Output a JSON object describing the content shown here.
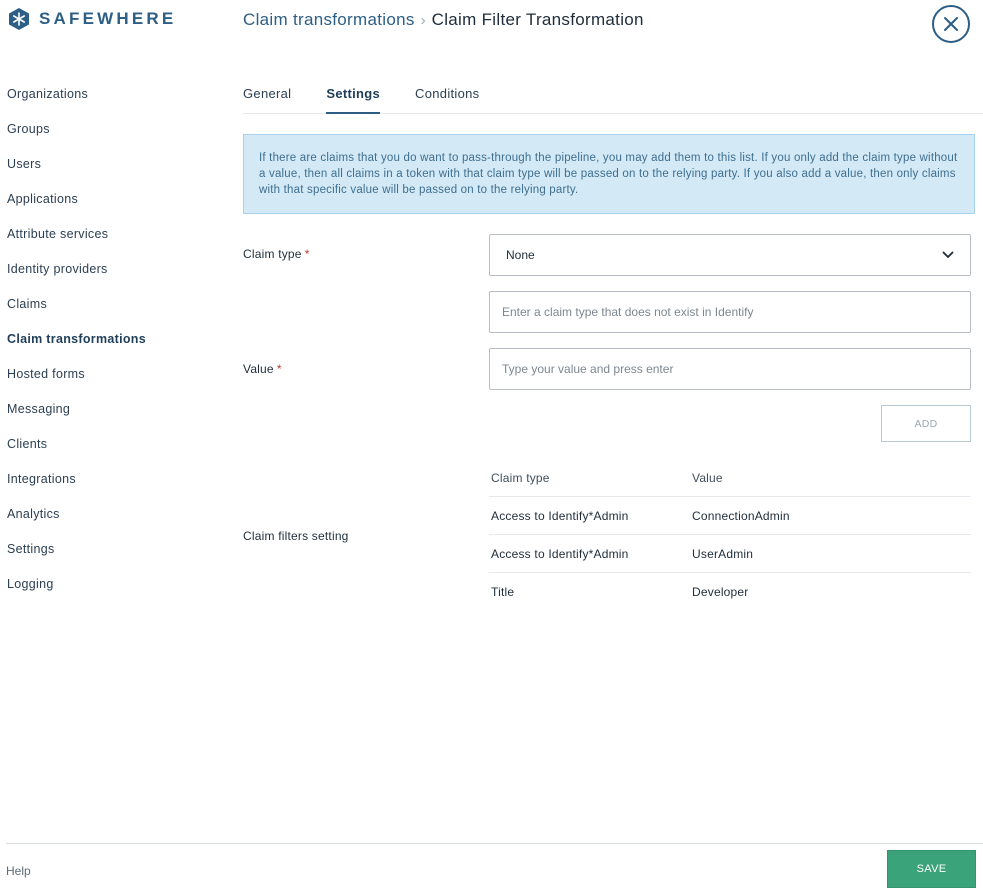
{
  "brand": {
    "name": "SAFEWHERE",
    "logo_icon": "snowflake-hex-icon",
    "color": "#2d5f86"
  },
  "breadcrumb": {
    "parent": "Claim transformations",
    "separator": "›",
    "current": "Claim Filter Transformation"
  },
  "sidebar": {
    "items": [
      {
        "label": "Organizations"
      },
      {
        "label": "Groups"
      },
      {
        "label": "Users"
      },
      {
        "label": "Applications"
      },
      {
        "label": "Attribute services"
      },
      {
        "label": "Identity providers"
      },
      {
        "label": "Claims"
      },
      {
        "label": "Claim transformations"
      },
      {
        "label": "Hosted forms"
      },
      {
        "label": "Messaging"
      },
      {
        "label": "Clients"
      },
      {
        "label": "Integrations"
      },
      {
        "label": "Analytics"
      },
      {
        "label": "Settings"
      },
      {
        "label": "Logging"
      }
    ],
    "active": "Claim transformations"
  },
  "tabs": [
    {
      "label": "General"
    },
    {
      "label": "Settings"
    },
    {
      "label": "Conditions"
    }
  ],
  "active_tab": "Settings",
  "info": {
    "text": "If there are claims that you do want to pass-through the pipeline, you may add them to this list. If you only add the claim type without a value, then all claims in a token with that claim type will be passed on to the relying party. If you also add a value, then only claims with that specific value will be passed on to the relying party."
  },
  "form": {
    "claim_type_label": "Claim type",
    "required_mark": "*",
    "claim_type_selected": "None",
    "custom_claim_placeholder": "Enter a claim type that does not exist in Identify",
    "value_label": "Value",
    "value_placeholder": "Type your value and press enter",
    "add_label": "ADD",
    "claim_filters_label": "Claim filters setting"
  },
  "table": {
    "headers": [
      "Claim type",
      "Value"
    ],
    "rows": [
      [
        "Access to Identify*Admin",
        "ConnectionAdmin"
      ],
      [
        "Access to Identify*Admin",
        "UserAdmin"
      ],
      [
        "Title",
        "Developer"
      ]
    ]
  },
  "footer": {
    "help_label": "Help",
    "save_label": "SAVE",
    "save_color": "#3aa37a"
  }
}
